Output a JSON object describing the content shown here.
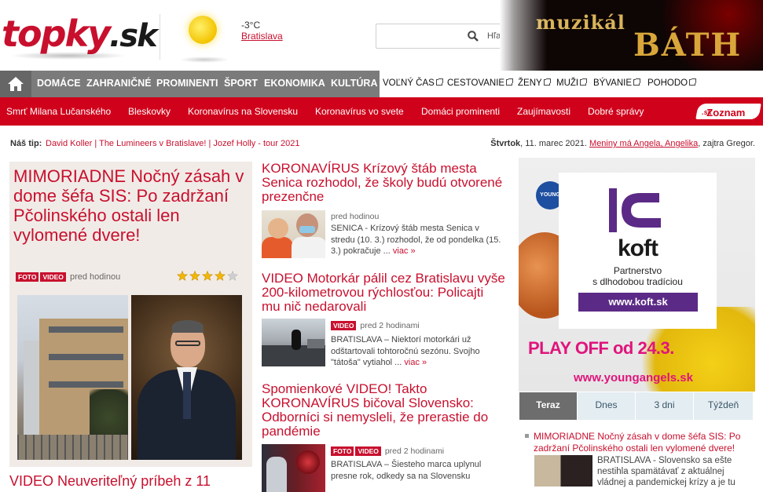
{
  "header": {
    "logo_main": "topky",
    "logo_suffix": ".sk",
    "weather_temp": "-3°C",
    "weather_city": "Bratislava",
    "search_placeholder": "",
    "search_label": "Hľadaj"
  },
  "top_ad": {
    "line1": "muzikál",
    "line2": "BÁTH"
  },
  "main_nav": {
    "items": [
      "DOMÁCE",
      "ZAHRANIČNÉ",
      "PROMINENTI",
      "ŠPORT",
      "EKONOMIKA",
      "KULTÚRA"
    ],
    "external": [
      "VOĽNÝ ČAS",
      "CESTOVANIE",
      "ŽENY",
      "MUŽI",
      "BÝVANIE",
      "POHODO"
    ]
  },
  "sub_nav": {
    "items": [
      "Smrť Milana Lučanského",
      "Bleskovky",
      "Koronavírus na Slovensku",
      "Koronavírus vo svete",
      "Domáci prominenti",
      "Zaujímavosti",
      "Dobré správy"
    ],
    "partner": "Zoznam",
    "partner_suffix": ".sk"
  },
  "tip_bar": {
    "label": "Náš tip:",
    "links": [
      "David Koller",
      "The Lumineers v Bratislave!",
      "Jozef Holly - tour 2021"
    ],
    "day": "Štvrtok",
    "date": ", 11. marec 2021.",
    "nameday": "Meniny má Angela, Angelika",
    "tomorrow": ", zajtra Gregor."
  },
  "feature": {
    "title_prefix": "MIMORIADNE",
    "title": " Nočný zásah v dome šéfa SIS: Po zadržaní Pčolinského ostali len vylomené dvere!",
    "badges": [
      "FOTO",
      "VIDEO"
    ],
    "time": "pred hodinou",
    "rating": 4,
    "rating_max": 5
  },
  "bottom_left_title": "VIDEO Neuveriteľný príbeh z 11",
  "articles": [
    {
      "title": "KORONAVÍRUS Krízový štáb mesta Senica rozhodol, že školy budú otvorené prezenčne",
      "badges": [],
      "time": "pred hodinou",
      "text": "SENICA - Krízový štáb mesta Senica v stredu (10. 3.) rozhodol, že od pondelka (15. 3.) pokračuje ... ",
      "more": "viac »"
    },
    {
      "title": "VIDEO Motorkár pálil cez Bratislavu vyše 200-kilometrovou rýchlosťou: Policajti mu nič nedarovali",
      "badges": [
        "VIDEO"
      ],
      "time": "pred 2 hodinami",
      "text": "BRATISLAVA – Niektorí motorkári už odštartovali tohtoročnú sezónu. Svojho \"tátoša\" vytiahol ... ",
      "more": "viac »"
    },
    {
      "title": "Spomienkové VIDEO! Takto KORONAVÍRUS bičoval Slovensko: Odborníci si nemysleli, že prerastie do pandémie",
      "badges": [
        "FOTO",
        "VIDEO"
      ],
      "time": "pred 2 hodinami",
      "text": "BRATISLAVA – Šiesteho marca uplynul presne rok, odkedy sa na Slovensku",
      "more": ""
    }
  ],
  "right_ad": {
    "logo_word": "koft",
    "line1": "Partnerstvo",
    "line2": "s dlhodobou tradíciou",
    "url": "www.koft.sk",
    "playoff": "PLAY OFF od 24.3.",
    "site": "www.youngangels.sk",
    "badge": "YOUNG"
  },
  "tabs": [
    "Teraz",
    "Dnes",
    "3 dni",
    "Týždeň"
  ],
  "right_list": {
    "title": "MIMORIADNE Nočný zásah v dome šéfa SIS: Po zadržaní Pčolinského ostali len vylomené dvere!",
    "text": "BRATISLAVA - Slovensko sa ešte nestihla spamätávať z aktuálnej vládnej a pandemickej krízy a je tu"
  },
  "colors": {
    "accent": "#c8102e",
    "nav_dark": "#7b7b7b",
    "subnav_red": "#d0021b"
  }
}
